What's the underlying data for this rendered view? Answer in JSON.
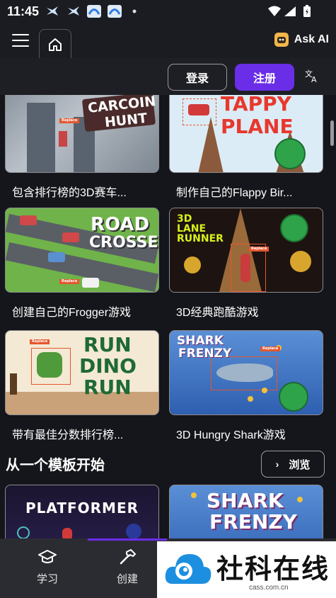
{
  "status_bar": {
    "time": "11:45",
    "icons": [
      "bird-app-icon",
      "bird-app-icon",
      "wave-app-icon",
      "wave-app-icon",
      "dot-icon",
      "wifi-icon",
      "signal-icon",
      "battery-icon"
    ]
  },
  "app_bar": {
    "menu_icon": "hamburger-menu-icon",
    "home_icon": "home-icon",
    "ask_ai_label": "Ask AI"
  },
  "auth": {
    "login_label": "登录",
    "register_label": "注册",
    "translate_icon": "translate-icon"
  },
  "games": [
    {
      "title": "包含排行榜的3D赛车...",
      "thumb_text": [
        "CARCOIN",
        "HUNT"
      ]
    },
    {
      "title": "制作自己的Flappy Bir...",
      "thumb_text": [
        "TAPPY",
        "PLANE"
      ]
    },
    {
      "title": "创建自己的Frogger游戏",
      "thumb_text": [
        "ROAD",
        "CROSSER"
      ]
    },
    {
      "title": "3D经典跑酷游戏",
      "thumb_text": [
        "3D",
        "LANE",
        "RUNNER"
      ]
    },
    {
      "title": "带有最佳分数排行榜...",
      "thumb_text": [
        "RUN",
        "DINO",
        "RUN"
      ]
    },
    {
      "title": "3D Hungry Shark游戏",
      "thumb_text": [
        "SHARK",
        "FRENZY"
      ]
    }
  ],
  "thumb_labels": {
    "replace": "Replace"
  },
  "templates_section": {
    "title": "从一个模板开始",
    "browse_label": "浏览",
    "templates": [
      {
        "thumb_text": [
          "PLATFORMER"
        ]
      },
      {
        "thumb_text": [
          "SHARK",
          "FRENZY"
        ]
      }
    ]
  },
  "bottom_nav": {
    "items": [
      {
        "label": "学习",
        "icon": "graduation-cap-icon"
      },
      {
        "label": "创建",
        "icon": "hammer-icon"
      }
    ]
  },
  "watermark": {
    "text": "社科在线",
    "url": "cass.com.cn"
  },
  "colors": {
    "background": "#15161b",
    "accent": "#6a2ee8",
    "bottom_nav": "#2b2c31"
  }
}
